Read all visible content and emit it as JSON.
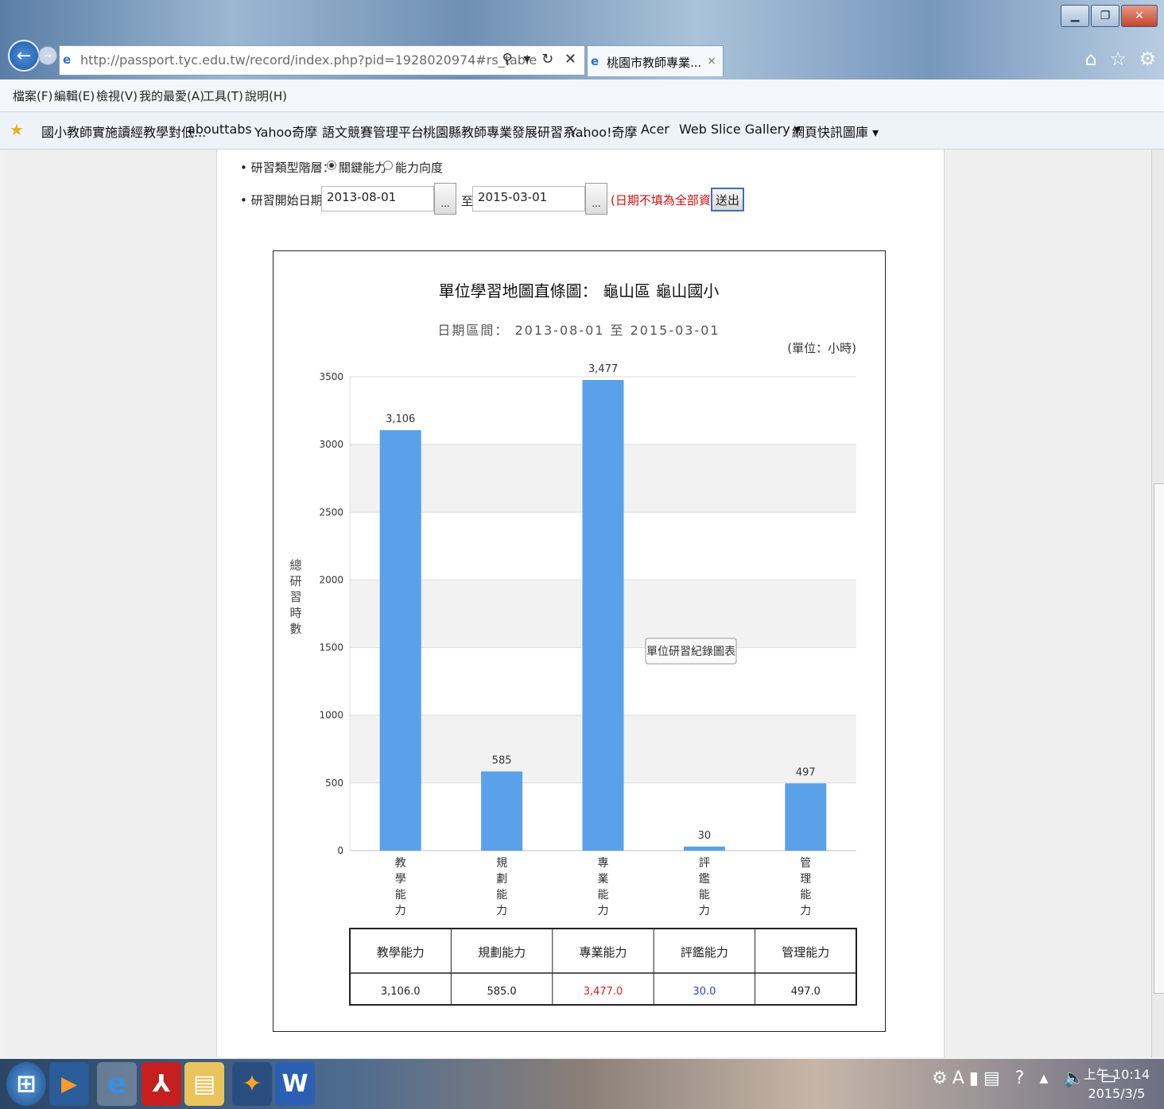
{
  "browser": {
    "url": "http://passport.tyc.edu.tw/record/index.php?pid=1928020974#rs_table",
    "tab_title": "桃園市教師專業...",
    "tab_close": "×",
    "menu": [
      "檔案(F)",
      "編輯(E)",
      "檢視(V)",
      "我的最愛(A)",
      "工具(T)",
      "說明(H)"
    ],
    "favorites": [
      "國小教師實施讀經教學對低...",
      "abouttabs",
      "Yahoo奇摩",
      "語文競賽管理平台",
      "桃園縣教師專業發展研習系...",
      "Yahoo!奇摩",
      "Acer",
      "Web Slice Gallery ▾",
      "網頁快訊圖庫 ▾"
    ]
  },
  "form": {
    "type_label": "研習類型階層：",
    "option_key": "關鍵能力",
    "option_dim": "能力向度",
    "date_label": "研習開始日期：",
    "start_date": "2013-08-01",
    "picker": "...",
    "to": "至",
    "end_date": "2015-03-01",
    "hint": "(日期不填為全部資料)",
    "submit": "送出"
  },
  "chart_data": {
    "type": "bar",
    "title": "單位學習地圖直條圖： 龜山區 龜山國小",
    "subtitle": "日期區間： 2013-08-01 至 2015-03-01",
    "unit_note": "(單位：小時)",
    "ylabel": "總研習時數",
    "categories": [
      "教學能力",
      "規劃能力",
      "專業能力",
      "評鑑能力",
      "管理能力"
    ],
    "values": [
      3106,
      585,
      3477,
      30,
      497
    ],
    "value_labels": [
      "3,106",
      "585",
      "3,477",
      "30",
      "497"
    ],
    "ylim": [
      0,
      3500
    ],
    "yticks": [
      0,
      500,
      1000,
      1500,
      2000,
      2500,
      3000,
      3500
    ],
    "bar_color": "#5aa1ea",
    "band_color": "#f2f2f2",
    "tooltip": "單位研習紀錄圖表",
    "table_values": [
      "3,106.0",
      "585.0",
      "3,477.0",
      "30.0",
      "497.0"
    ],
    "table_colors": [
      "#222222",
      "#222222",
      "#e02020",
      "#2a3fd6",
      "#222222"
    ]
  },
  "taskbar": {
    "clock_time": "上午 10:14",
    "clock_date": "2015/3/5"
  }
}
